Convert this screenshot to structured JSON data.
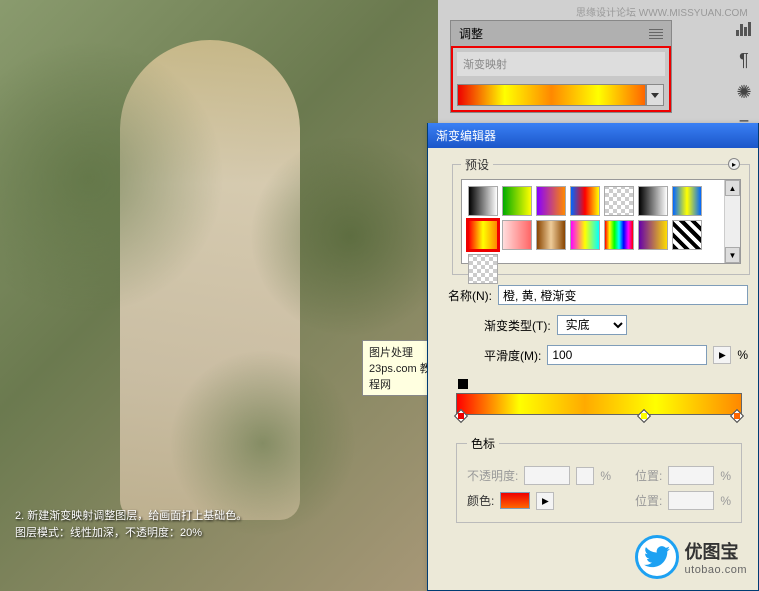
{
  "watermark": {
    "top": "思缘设计论坛   WWW.MISSYUAN.COM",
    "brand_cn": "优图宝",
    "brand_url": "utobao.com"
  },
  "image": {
    "tooltip_line1": "图片处理",
    "tooltip_line2": "23ps.com 教程网",
    "caption_line1": "2. 新建渐变映射调整图层，给画面打上基础色。",
    "caption_line2": "图层模式：线性加深，不透明度：20%"
  },
  "panel": {
    "tab": "调整",
    "field_label": "渐变映射"
  },
  "toolbar_icons": [
    "histogram-icon",
    "paragraph-icon",
    "wheel-icon",
    "align-icon",
    "layers-icon"
  ],
  "dialog": {
    "title": "渐变编辑器",
    "presets_label": "预设",
    "name_label": "名称(N):",
    "name_value": "橙, 黄, 橙渐变",
    "type_label": "渐变类型(T):",
    "type_value": "实底",
    "smooth_label": "平滑度(M):",
    "smooth_value": "100",
    "percent": "%",
    "stops_label": "色标",
    "opacity_label": "不透明度:",
    "position_label": "位置:",
    "color_label": "颜色:"
  },
  "swatches": [
    {
      "bg": "linear-gradient(90deg,#000,#fff)"
    },
    {
      "bg": "linear-gradient(90deg,#0a0,#ff0)"
    },
    {
      "bg": "linear-gradient(90deg,#80f,#f80)"
    },
    {
      "bg": "linear-gradient(90deg,#06f,#f00,#ff0)"
    },
    {
      "bg": "repeating-conic-gradient(#ccc 0 25%,#fff 0 50%) 0/8px 8px"
    },
    {
      "bg": "linear-gradient(90deg,#000,#fff)"
    },
    {
      "bg": "linear-gradient(90deg,#06f,#ff0,#06f)"
    },
    {
      "bg": "linear-gradient(90deg,#f00,#ff0,#f80)",
      "selected": true
    },
    {
      "bg": "linear-gradient(90deg,#fdd,#f66)"
    },
    {
      "bg": "linear-gradient(90deg,#840,#ec9,#840)"
    },
    {
      "bg": "linear-gradient(90deg,#f0f,#ff0,#0ff)"
    },
    {
      "bg": "linear-gradient(90deg,#f00,#ff0,#0f0,#0ff,#00f,#f0f,#f00)"
    },
    {
      "bg": "linear-gradient(90deg,#60a,#fd0)"
    },
    {
      "bg": "repeating-linear-gradient(45deg,#000 0 4px,#fff 4px 8px)"
    },
    {
      "bg": "repeating-conic-gradient(#ccc 0 25%,#fff 0 50%) 0/8px 8px"
    }
  ]
}
